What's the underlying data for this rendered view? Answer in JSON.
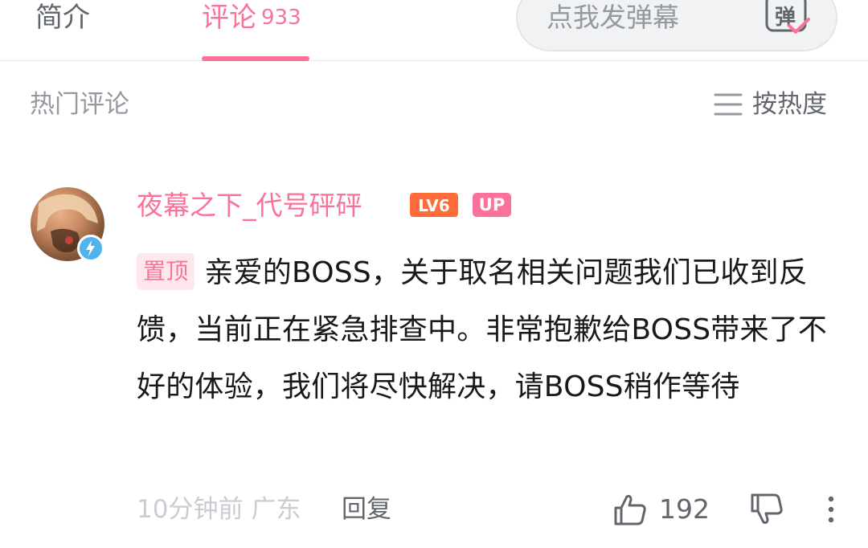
{
  "tabs": {
    "intro_label": "简介",
    "comments_label": "评论",
    "comments_count": "933"
  },
  "danmaku": {
    "placeholder": "点我发弹幕",
    "button_glyph": "弹"
  },
  "section": {
    "title": "热门评论",
    "sort_label": "按热度"
  },
  "comment": {
    "username": "夜幕之下_代号砰砰",
    "level_badge": "LV6",
    "up_badge": "UP",
    "pin_tag": "置顶",
    "text": "亲爱的BOSS，关于取名相关问题我们已收到反馈，当前正在紧急排查中。非常抱歉给BOSS带来了不好的体验，我们将尽快解决，请BOSS稍作等待",
    "time": "10分钟前",
    "location": "广东",
    "reply_label": "回复",
    "like_count": "192"
  },
  "colors": {
    "accent_pink": "#fb7299",
    "text_primary": "#18191c",
    "text_secondary": "#61666d",
    "text_muted": "#9499a0",
    "verified_blue": "#4fb4ee"
  },
  "icons": {
    "sort": "sort-lines-icon",
    "like": "thumbs-up-icon",
    "dislike": "thumbs-down-icon",
    "more": "more-vertical-icon",
    "danmaku": "danmaku-toggle-icon",
    "verified": "lightning-verified-icon"
  }
}
